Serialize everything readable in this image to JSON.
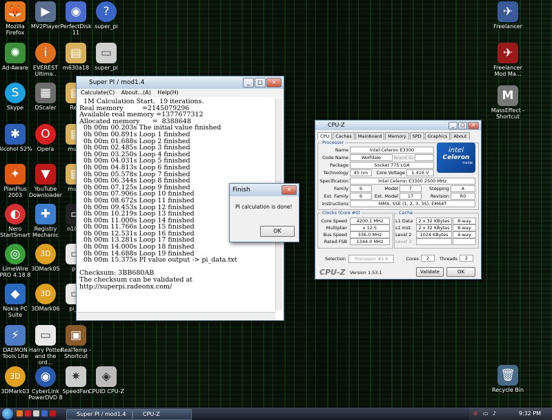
{
  "desktop_icons": [
    {
      "label": "Mozilla Firefox",
      "glyph": "🦊",
      "color": "#e8761c"
    },
    {
      "label": "MV2Player",
      "glyph": "▶",
      "color": "#5a6f8f"
    },
    {
      "label": "PerfectDisk 11",
      "glyph": "◉",
      "color": "#4a6bd0"
    },
    {
      "label": "super_pi",
      "glyph": "?",
      "color": "#3a66c8"
    },
    {
      "label": "Ad-Aware",
      "glyph": "✺",
      "color": "#3b8f3b"
    },
    {
      "label": "EVEREST Ultima..",
      "glyph": "i",
      "color": "#e07020"
    },
    {
      "label": "m630a18",
      "glyph": "▤",
      "color": "#d8b15a"
    },
    {
      "label": "super_pi",
      "glyph": "▭",
      "color": "#d0d0d0"
    },
    {
      "label": "Skype",
      "glyph": "S",
      "color": "#1aa0e0"
    },
    {
      "label": "DScaler",
      "glyph": "▦",
      "color": "#6c6c6c"
    },
    {
      "label": "Real",
      "glyph": "▤",
      "color": "#d8b15a"
    },
    {
      "label": "Alcohol 52%",
      "glyph": "✱",
      "color": "#2b5fb8"
    },
    {
      "label": "Opera",
      "glyph": "O",
      "color": "#d81e1e"
    },
    {
      "label": "music",
      "glyph": "▤",
      "color": "#d8b15a"
    },
    {
      "label": "PlanPlus 2003",
      "glyph": "✦",
      "color": "#e05a14"
    },
    {
      "label": "YouTube Downloader",
      "glyph": "▼",
      "color": "#c01818"
    },
    {
      "label": "music",
      "glyph": "▤",
      "color": "#d8b15a"
    },
    {
      "label": "Nero StartSmart",
      "glyph": "◐",
      "color": "#d83030"
    },
    {
      "label": "Registry Mechanic",
      "glyph": "✚",
      "color": "#3c7fd0"
    },
    {
      "label": "n1000",
      "glyph": "▭",
      "color": "#222222"
    },
    {
      "label": "LimeWire PRO 4.18.8",
      "glyph": "◎",
      "color": "#3aa03a"
    },
    {
      "label": "3DMark05",
      "glyph": "3D",
      "color": "#e0a020"
    },
    {
      "label": "pi_",
      "glyph": "▭",
      "color": "#e8e8e8"
    },
    {
      "label": "Nokia PC Suite",
      "glyph": "◆",
      "color": "#2a6ac0"
    },
    {
      "label": "3DMark06",
      "glyph": "3D",
      "color": "#e0a020"
    },
    {
      "label": "pi_re",
      "glyph": "▭",
      "color": "#e8e8e8"
    },
    {
      "label": "DAEMON Tools Lite",
      "glyph": "⚡",
      "color": "#4e7bc6"
    },
    {
      "label": "Harry Potter and the ord...",
      "glyph": "▭",
      "color": "#e8e8e8"
    },
    {
      "label": "RealTemp - Shortcut",
      "glyph": "▣",
      "color": "#8a5a2a"
    },
    {
      "label": "3DMark03",
      "glyph": "3D",
      "color": "#e0a020"
    },
    {
      "label": "CyberLink PowerDVD 8",
      "glyph": "◉",
      "color": "#2a5ab0"
    },
    {
      "label": "SpeedFan",
      "glyph": "✷",
      "color": "#cccccc"
    },
    {
      "label": "CPUID CPU-Z",
      "glyph": "◈",
      "color": "#bbbbbb"
    },
    {
      "label": "Freelancer",
      "glyph": "✈",
      "color": "#3a5a9a"
    },
    {
      "label": "Freelancer Mod Ma...",
      "glyph": "✈",
      "color": "#9a1a1a"
    },
    {
      "label": "MassEffect - Shortcut",
      "glyph": "M",
      "color": "#777777"
    },
    {
      "label": "Recycle Bin",
      "glyph": "🗑",
      "color": "#4a6a8a"
    }
  ],
  "superpi": {
    "title": "Super PI / mod1.4",
    "menu": [
      "Calculate(C)",
      "About...(A)",
      "Help(H)"
    ],
    "output": "  1M Calculation Start.  19 iterations.\nReal memory         =2145079296\nAvailable real memory =1377677312\nAllocated memory      =  8388648\n  0h 00m 00.203s The initial value finished\n  0h 00m 00.891s Loop 1 finished\n  0h 00m 01.688s Loop 2 finished\n  0h 00m 02.485s Loop 3 finished\n  0h 00m 03.250s Loop 4 finished\n  0h 00m 04.031s Loop 5 finished\n  0h 00m 04.813s Loop 6 finished\n  0h 00m 05.578s Loop 7 finished\n  0h 00m 06.344s Loop 8 finished\n  0h 00m 07.125s Loop 9 finished\n  0h 00m 07.906s Loop 10 finished\n  0h 00m 08.672s Loop 11 finished\n  0h 00m 09.453s Loop 12 finished\n  0h 00m 10.219s Loop 13 finished\n  0h 00m 11.000s Loop 14 finished\n  0h 00m 11.766s Loop 15 finished\n  0h 00m 12.531s Loop 16 finished\n  0h 00m 13.281s Loop 17 finished\n  0h 00m 14.000s Loop 18 finished\n  0h 00m 14.688s Loop 19 finished\n  0h 00m 15.375s PI value output -> pi_data.txt\n\nChecksum: 3BB680AB\nThe checksum can be validated at\nhttp://superpi.radeonx.com/"
  },
  "finish": {
    "title": "Finish",
    "message": "PI calculation is done!",
    "ok": "OK"
  },
  "cpuz": {
    "title": "CPU-Z",
    "tabs": [
      "CPU",
      "Caches",
      "Mainboard",
      "Memory",
      "SPD",
      "Graphics",
      "About"
    ],
    "processor_legend": "Processor",
    "name_label": "Name",
    "name": "Intel Celeron E3300",
    "codename_label": "Code Name",
    "codename": "Wolfdale",
    "brandid_label": "Brand ID",
    "package_label": "Package",
    "package": "Socket 775 LGA",
    "tech_label": "Technology",
    "tech": "45 nm",
    "voltage_label": "Core Voltage",
    "voltage": "1.416 V",
    "spec_label": "Specification",
    "spec": "Intel Celeron E3300 2500 MHz",
    "family_label": "Family",
    "family": "6",
    "model_label": "Model",
    "model": "7",
    "stepping_label": "Stepping",
    "stepping": "A",
    "extfamily_label": "Ext. Family",
    "extfamily": "6",
    "extmodel_label": "Ext. Model",
    "extmodel": "17",
    "revision_label": "Revision",
    "revision": "R0",
    "instr_label": "Instructions",
    "instructions": "MMX, SSE (1, 2, 3, 3S), EM64T",
    "logo": {
      "brand": "intel",
      "product": "Celeron",
      "tagline": "inside"
    },
    "clocks_legend": "Clocks (Core #0)",
    "corespeed_label": "Core Speed",
    "corespeed": "4200.1 MHz",
    "multiplier_label": "Multiplier",
    "multiplier": "x 12.5",
    "busspeed_label": "Bus Speed",
    "busspeed": "336.0 MHz",
    "ratedfsb_label": "Rated FSB",
    "ratedfsb": "1344.0 MHz",
    "cache_legend": "Cache",
    "l1d_label": "L1 Data",
    "l1d": "2 x 32 KBytes",
    "l1d_way": "8-way",
    "l1i_label": "L1 Inst.",
    "l1i": "2 x 32 KBytes",
    "l1i_way": "8-way",
    "l2_label": "Level 2",
    "l2": "1024 KBytes",
    "l2_way": "4-way",
    "l3_label": "Level 3",
    "selection_label": "Selection",
    "selection": "Processor #1",
    "cores_label": "Cores",
    "cores": "2",
    "threads_label": "Threads",
    "threads": "2",
    "logo_text": "CPU-Z",
    "version": "Version 1.53.1",
    "validate": "Validate",
    "ok": "OK"
  },
  "taskbar": {
    "buttons": [
      "Super PI / mod1.4",
      "CPU-Z"
    ],
    "clock": "9:32 PM"
  }
}
